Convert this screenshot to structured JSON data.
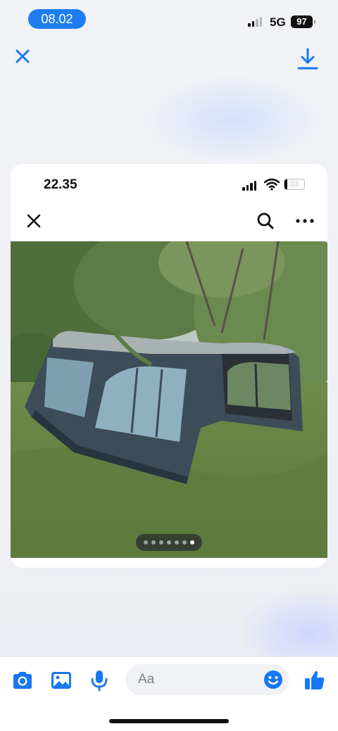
{
  "status_bar": {
    "time": "08.02",
    "network": "5G",
    "battery": "97"
  },
  "top_actions": {
    "close_icon": "close-icon",
    "download_icon": "download-icon"
  },
  "inner_screenshot": {
    "time": "22.35",
    "battery": "23",
    "toolbar": {
      "close_icon": "close-icon",
      "search_icon": "search-icon",
      "more_icon": "more-horizontal-icon"
    },
    "photo": {
      "subject": "tent-photo",
      "pagination": {
        "total": 7,
        "active": 7
      }
    }
  },
  "composer": {
    "placeholder": "Aa",
    "icons": [
      "camera-icon",
      "image-icon",
      "microphone-icon",
      "emoji-icon",
      "thumbs-up-icon"
    ],
    "accent_color": "#1877f2"
  }
}
